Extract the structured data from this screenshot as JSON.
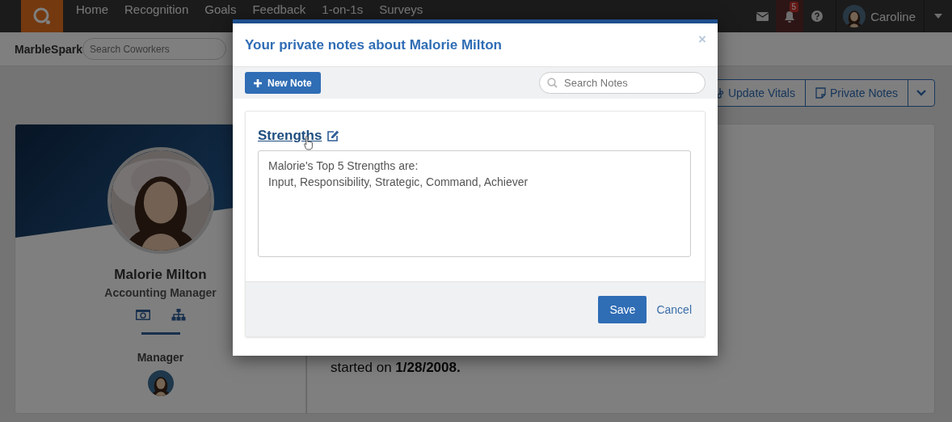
{
  "navbar": {
    "menu": [
      "Home",
      "Recognition",
      "Goals",
      "Feedback",
      "1-on-1s",
      "Surveys"
    ],
    "notification_count": "5",
    "user_name": "Caroline"
  },
  "header": {
    "brand": "MarbleSpark",
    "search": {
      "placeholder": "Search Coworkers"
    }
  },
  "actions": [
    {
      "label": "Update Vitals",
      "kind": "vitals"
    },
    {
      "label": "Private Notes",
      "kind": "notes"
    }
  ],
  "profile": {
    "name": "Malorie Milton",
    "title": "Accounting Manager",
    "manager_label": "Manager"
  },
  "details": {
    "text": "started on **1/28/2008.**"
  },
  "modal": {
    "title": "Your private notes about Malorie Milton",
    "close": "×",
    "new_note": "New Note",
    "search": {
      "placeholder": "Search Notes"
    },
    "note": {
      "title": "Strengths",
      "lines": [
        "Malorie's Top 5 Strengths are:",
        "Input, Responsibility, Strategic, Command, Achiever"
      ]
    },
    "save": "Save",
    "cancel": "Cancel"
  }
}
